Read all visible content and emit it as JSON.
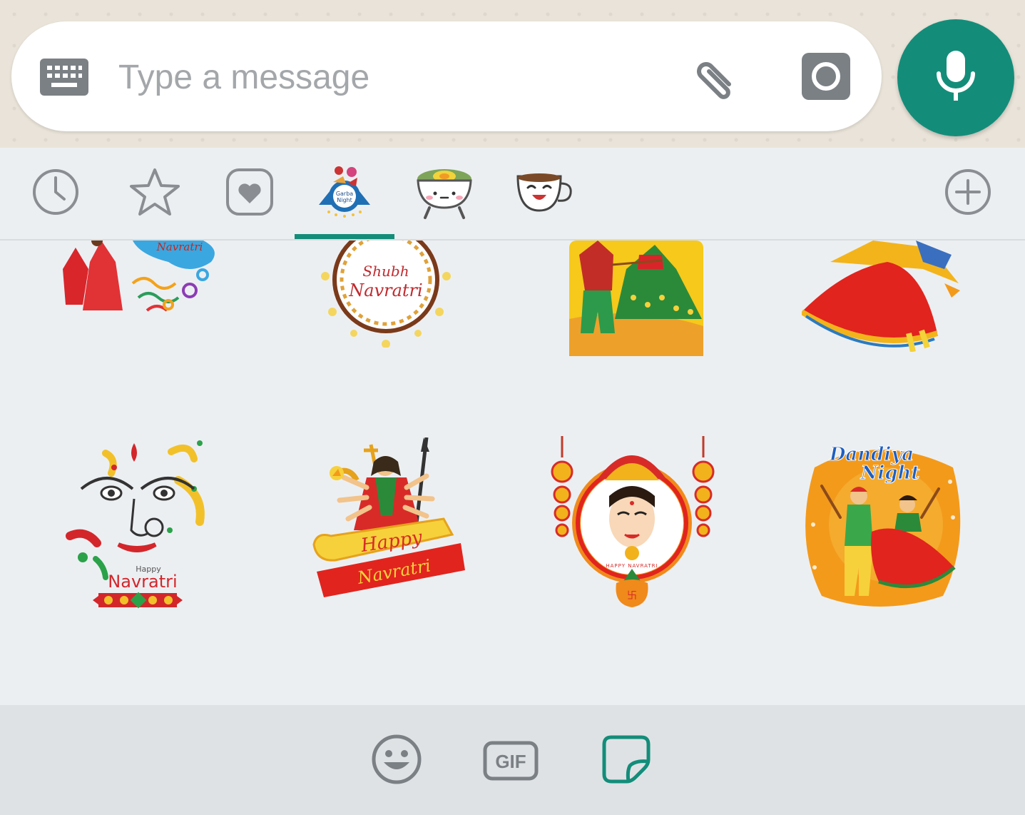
{
  "composer": {
    "placeholder": "Type a message",
    "keyboard_icon": "keyboard-icon",
    "attach_icon": "paperclip-icon",
    "camera_icon": "camera-icon",
    "mic_icon": "microphone-icon"
  },
  "tray_tabs": [
    {
      "name": "recent",
      "icon": "clock-icon"
    },
    {
      "name": "favorites",
      "icon": "star-icon"
    },
    {
      "name": "liked",
      "icon": "heart-icon"
    },
    {
      "name": "garba-night-pack",
      "icon": "garba-sticker-pack-icon",
      "selected": true,
      "pack_label": "Garba Night"
    },
    {
      "name": "food-pack",
      "icon": "food-bowl-sticker-pack-icon"
    },
    {
      "name": "cuppy-pack",
      "icon": "coffee-cup-sticker-pack-icon"
    },
    {
      "name": "add",
      "icon": "plus-icon"
    }
  ],
  "stickers": [
    {
      "id": "navratri-dancers",
      "text": "Navratri"
    },
    {
      "id": "shubh-navratri",
      "line1": "Shubh",
      "line2": "Navratri"
    },
    {
      "id": "dandiya-couple"
    },
    {
      "id": "garba-dancer"
    },
    {
      "id": "happy-navratri-face",
      "small": "Happy",
      "big": "Navratri"
    },
    {
      "id": "durga-happy-navratri",
      "line1": "Happy",
      "line2": "Navratri"
    },
    {
      "id": "durga-face",
      "caption": "HAPPY NAVRATRI"
    },
    {
      "id": "dandiya-night",
      "line1": "Dandiya",
      "line2": "Night"
    }
  ],
  "bottom_tabs": [
    {
      "name": "emoji",
      "icon": "smiley-icon"
    },
    {
      "name": "gif",
      "label": "GIF"
    },
    {
      "name": "stickers",
      "icon": "sticker-icon",
      "selected": true
    }
  ],
  "colors": {
    "accent": "#138d7a",
    "icon_gray": "#7b8085",
    "tray_bg": "#eceff2"
  }
}
